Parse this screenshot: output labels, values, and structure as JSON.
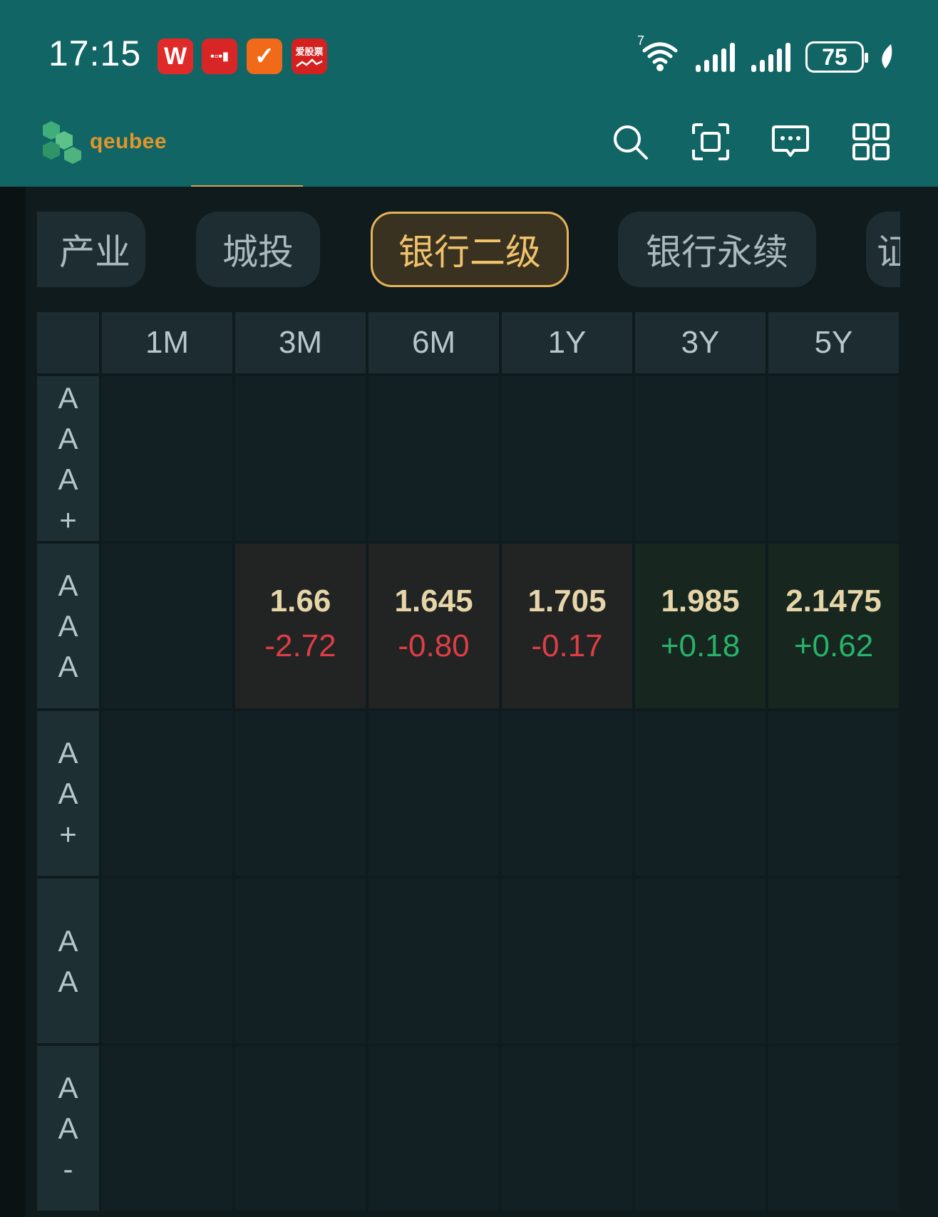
{
  "status_bar": {
    "time": "17:15",
    "notification_icons": [
      "W",
      "•▫•▮",
      "✓",
      "爱股票"
    ],
    "wifi_label": "7",
    "battery": "75"
  },
  "header": {
    "brand": "qeubee",
    "actions": [
      "search-icon",
      "scan-icon",
      "message-icon",
      "grid-icon"
    ]
  },
  "chips": [
    "产业",
    "城投",
    "银行二级",
    "银行永续",
    "证"
  ],
  "active_chip": "银行二级",
  "table": {
    "columns": [
      "1M",
      "3M",
      "6M",
      "1Y",
      "3Y",
      "5Y"
    ],
    "rows": [
      {
        "label": [
          "A",
          "A",
          "A",
          "+"
        ],
        "cells": [
          null,
          null,
          null,
          null,
          null,
          null
        ]
      },
      {
        "label": [
          "A",
          "A",
          "A"
        ],
        "cells": [
          null,
          {
            "yield": "1.66",
            "change": "-2.72",
            "dir": "down"
          },
          {
            "yield": "1.645",
            "change": "-0.80",
            "dir": "down"
          },
          {
            "yield": "1.705",
            "change": "-0.17",
            "dir": "down"
          },
          {
            "yield": "1.985",
            "change": "+0.18",
            "dir": "up"
          },
          {
            "yield": "2.1475",
            "change": "+0.62",
            "dir": "up"
          }
        ]
      },
      {
        "label": [
          "A",
          "A",
          "+"
        ],
        "cells": [
          null,
          null,
          null,
          null,
          null,
          null
        ]
      },
      {
        "label": [
          "A",
          "A"
        ],
        "cells": [
          null,
          null,
          null,
          null,
          null,
          null
        ]
      },
      {
        "label": [
          "A",
          "A",
          "-"
        ],
        "cells": [
          null,
          null,
          null,
          null,
          null,
          null
        ]
      }
    ]
  },
  "colors": {
    "header_bg": "#126565",
    "accent": "#e5b45a",
    "negative": "#e03d45",
    "positive": "#27b36a"
  }
}
